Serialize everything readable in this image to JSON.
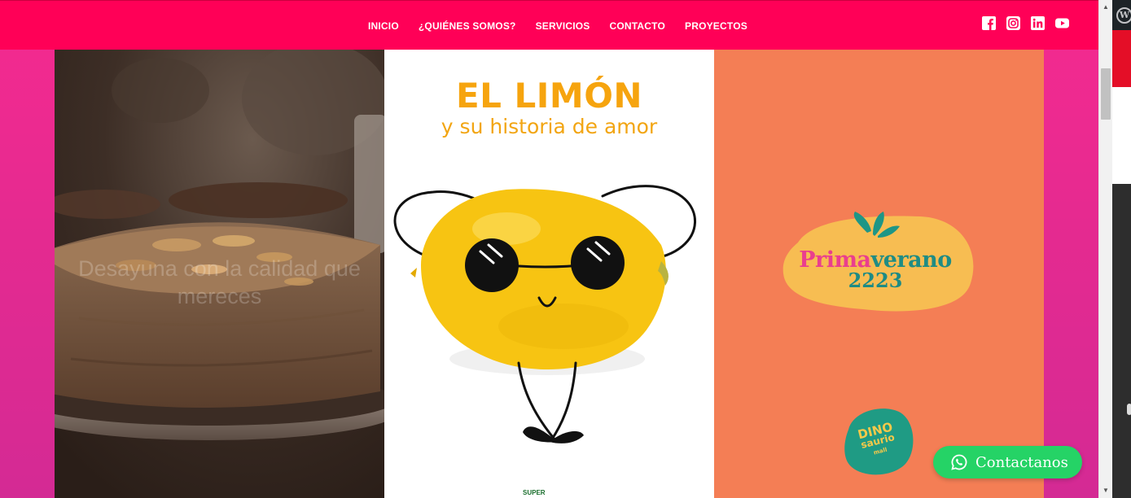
{
  "nav": {
    "items": [
      {
        "label": "INICIO"
      },
      {
        "label": "¿QUIÉNES SOMOS?"
      },
      {
        "label": "SERVICIOS"
      },
      {
        "label": "CONTACTO"
      },
      {
        "label": "PROYECTOS"
      }
    ],
    "social": [
      "facebook-icon",
      "instagram-icon",
      "linkedin-icon",
      "youtube-icon"
    ],
    "bg_color": "#ff0057"
  },
  "tiles": {
    "cake": {
      "overlay_text": "Desayuna con la calidad que mereces"
    },
    "limon": {
      "title": "EL LIMÓN",
      "subtitle": "y su historia de amor",
      "footer_brand": "SUPER"
    },
    "primaverano": {
      "word_a": "Prima",
      "word_b": "verano",
      "year": "2223",
      "badge_l1": "DINO",
      "badge_l2": "saurio",
      "badge_l3": "mall"
    }
  },
  "whatsapp": {
    "label": "Contactanos",
    "color": "#25d366"
  },
  "colors": {
    "page_pink": "#e52a90",
    "lemon": "#f6c40e",
    "peach": "#f47e55",
    "teal": "#1f8c84"
  }
}
